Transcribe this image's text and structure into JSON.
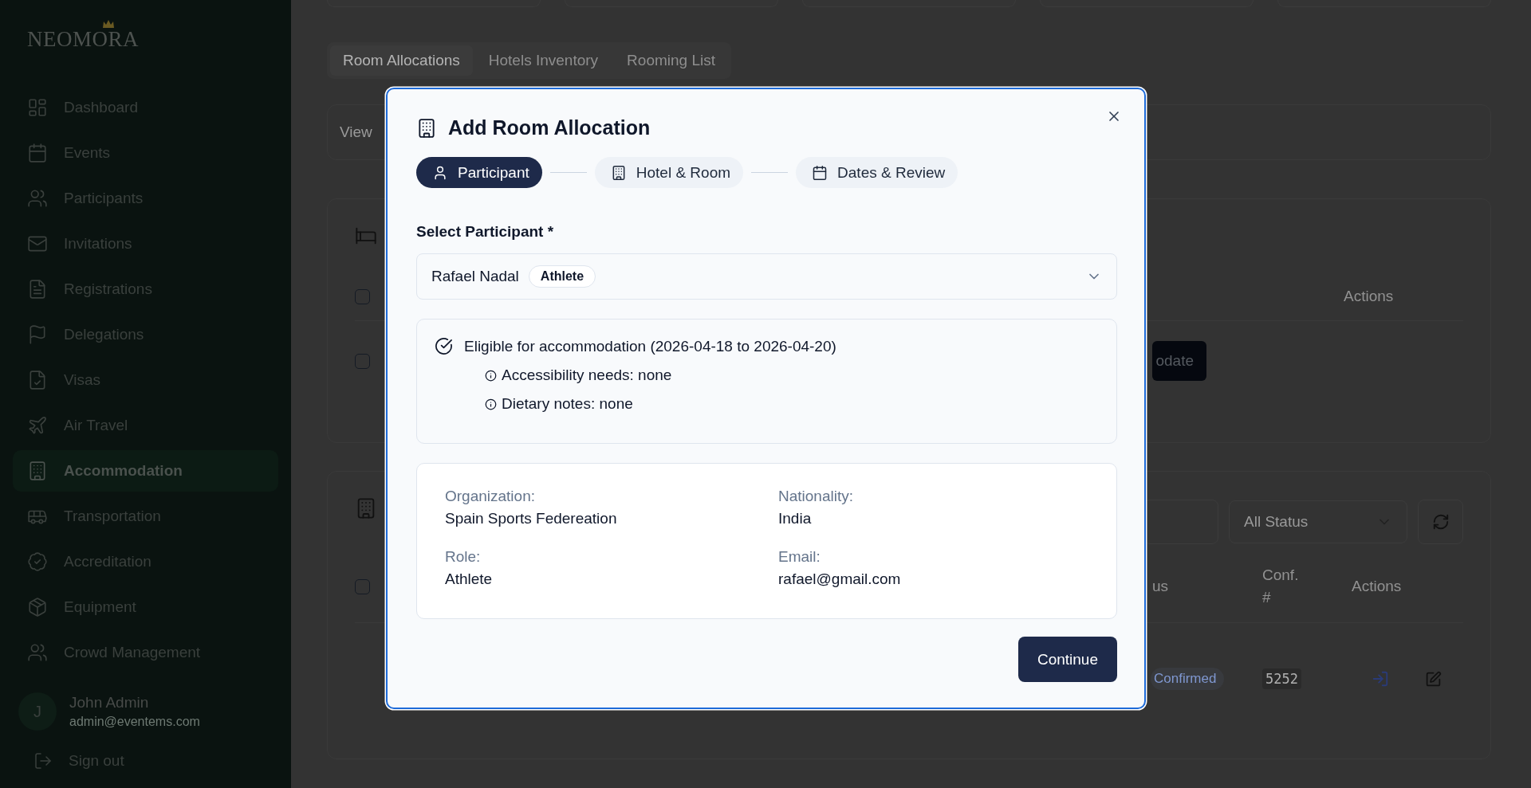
{
  "sidebar": {
    "logo": "NEOMORA",
    "items": [
      {
        "label": "Dashboard",
        "selected": false
      },
      {
        "label": "Events",
        "selected": false
      },
      {
        "label": "Participants",
        "selected": false
      },
      {
        "label": "Invitations",
        "selected": false
      },
      {
        "label": "Registrations",
        "selected": false
      },
      {
        "label": "Delegations",
        "selected": false
      },
      {
        "label": "Visas",
        "selected": false
      },
      {
        "label": "Air Travel",
        "selected": false
      },
      {
        "label": "Accommodation",
        "selected": true
      },
      {
        "label": "Transportation",
        "selected": false
      },
      {
        "label": "Accreditation",
        "selected": false
      },
      {
        "label": "Equipment",
        "selected": false
      },
      {
        "label": "Crowd Management",
        "selected": false
      }
    ],
    "user": {
      "initial": "J",
      "name": "John Admin",
      "email": "admin@eventems.com"
    },
    "sign_out": "Sign out"
  },
  "tabs": [
    {
      "label": "Room Allocations",
      "selected": true
    },
    {
      "label": "Hotels Inventory",
      "selected": false
    },
    {
      "label": "Rooming List",
      "selected": false
    }
  ],
  "view_bar": {
    "text": "View"
  },
  "participants_card": {
    "header": {
      "checked": false,
      "actions": "Actions"
    },
    "rows": [
      {
        "checked": false,
        "button": "odate"
      }
    ]
  },
  "allocations_card": {
    "status_filter": "All Status",
    "header": {
      "checked": false,
      "columns": [
        "us",
        "Conf. #",
        "Actions"
      ]
    },
    "rows": [
      {
        "status": "Confirmed",
        "conf": "5252"
      }
    ]
  },
  "dialog": {
    "title": "Add Room Allocation",
    "steps": [
      {
        "label": "Participant",
        "selected": true,
        "kind": "person"
      },
      {
        "label": "Hotel & Room",
        "selected": false,
        "kind": "building"
      },
      {
        "label": "Dates & Review",
        "selected": false,
        "kind": "calendar"
      }
    ],
    "field_label": "Select Participant *",
    "participant": {
      "name": "Rafael Nadal",
      "badge": "Athlete"
    },
    "eligibility": {
      "title": "Eligible for accommodation (2026-04-18 to 2026-04-20)",
      "notes": [
        "Accessibility needs: none",
        "Dietary notes: none"
      ]
    },
    "details": [
      {
        "label": "Organization:",
        "value": "Spain Sports Federeation"
      },
      {
        "label": "Nationality:",
        "value": "India"
      },
      {
        "label": "Role:",
        "value": "Athlete"
      },
      {
        "label": "Email:",
        "value": "rafael@gmail.com"
      }
    ],
    "continue": "Continue"
  }
}
